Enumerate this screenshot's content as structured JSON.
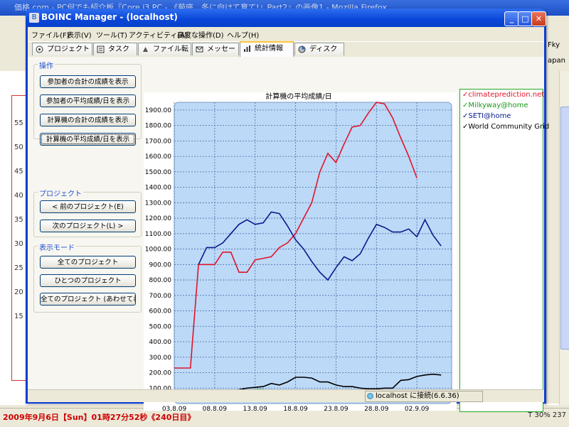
{
  "background": {
    "firefox_title": "価格.com - PC何でも紹介板『Core i3 PC - 《菊座、冬に向けて育て!』Part2』の画像1 - Mozilla Firefox",
    "status_text": "2009年9月6日【Sun】01時27分52秒《240日目》",
    "tray_text": "T 30% 237",
    "left_axis_nums": [
      "55",
      "50",
      "45",
      "40",
      "35",
      "30",
      "25",
      "20",
      "15"
    ],
    "right_notes": [
      "Fky",
      "apan"
    ]
  },
  "window": {
    "title": "BOINC Manager - (localhost)",
    "title_icon": "boinc-icon",
    "controls": [
      "_",
      "□",
      "✕"
    ]
  },
  "menu": [
    "ファイル(F)",
    "表示(V)",
    "ツール(T)",
    "アクティビティ(A)",
    "高度な操作(D)",
    "ヘルプ(H)"
  ],
  "tabs": [
    {
      "label": "プロジェクト",
      "icon": "projects-icon"
    },
    {
      "label": "タスク",
      "icon": "tasks-icon"
    },
    {
      "label": "ファイル転送",
      "icon": "transfers-icon"
    },
    {
      "label": "メッセージ",
      "icon": "messages-icon"
    },
    {
      "label": "統計情報",
      "icon": "statistics-icon",
      "active": true
    },
    {
      "label": "ディスク",
      "icon": "disk-icon"
    }
  ],
  "sidebar": {
    "ops_label": "操作",
    "ops_buttons": [
      "参加者の合計の成績を表示",
      "参加者の平均成績/日を表示",
      "計算機の合計の成績を表示",
      "計算機の平均成績/日を表示"
    ],
    "project_label": "プロジェクト",
    "project_buttons": [
      "< 前のプロジェクト(E)",
      "次のプロジェクト(L) >"
    ],
    "mode_label": "表示モード",
    "mode_buttons": [
      "全てのプロジェクト",
      "ひとつのプロジェクト",
      "全てのプロジェクト (あわせて表示)"
    ]
  },
  "legend": [
    {
      "name": "climateprediction.net",
      "color": "#e0142a"
    },
    {
      "name": "Milkyway@home",
      "color": "#1a9a1a"
    },
    {
      "name": "SETI@home",
      "color": "#0a1a8c"
    },
    {
      "name": "World Community Grid",
      "color": "#000000"
    }
  ],
  "statusbar": {
    "connection": "localhost に接続(6.6.36)"
  },
  "chart_data": {
    "type": "line",
    "title": "計算機の平均成績/日",
    "xlabel": "",
    "ylabel": "",
    "x_ticks": [
      "03.8.09",
      "08.8.09",
      "13.8.09",
      "18.8.09",
      "23.8.09",
      "28.8.09",
      "02.9.09"
    ],
    "y_ticks": [
      "100.00",
      "200.00",
      "300.00",
      "400.00",
      "500.00",
      "600.00",
      "700.00",
      "800.00",
      "900.00",
      "1000.00",
      "1100.00",
      "1200.00",
      "1300.00",
      "1400.00",
      "1500.00",
      "1600.00",
      "1700.00",
      "1800.00",
      "1900.00"
    ],
    "ylim": [
      0,
      1950
    ],
    "xlim": [
      3,
      37.3
    ],
    "grid": true,
    "bg_color": "#bcd9f7",
    "series": [
      {
        "name": "climateprediction.net",
        "color": "#e0142a",
        "x": [
          3,
          4,
          5,
          6,
          7,
          8,
          9,
          10,
          11,
          12,
          13,
          14,
          15,
          16,
          17,
          18,
          19,
          20,
          21,
          22,
          23,
          24,
          25,
          26,
          27,
          28,
          29,
          30,
          31,
          32,
          33
        ],
        "y": [
          230,
          230,
          230,
          900,
          900,
          900,
          980,
          980,
          850,
          850,
          930,
          940,
          950,
          1010,
          1040,
          1100,
          1200,
          1300,
          1500,
          1620,
          1560,
          1680,
          1790,
          1800,
          1880,
          1950,
          1940,
          1850,
          1720,
          1600,
          1460
        ]
      },
      {
        "name": "Milkyway@home",
        "color": "#1a9a1a",
        "x": [
          5,
          6,
          7,
          8,
          9,
          10,
          11,
          12,
          13,
          14,
          15,
          16,
          17,
          18,
          19,
          20,
          21,
          22,
          23,
          24,
          25,
          26,
          27,
          28,
          29,
          30,
          31,
          32,
          33
        ],
        "y": [
          40,
          40,
          40,
          40,
          50,
          60,
          70,
          80,
          90,
          90,
          80,
          75,
          70,
          65,
          60,
          55,
          50,
          45,
          40,
          40,
          40,
          40,
          30,
          30,
          30,
          35,
          40,
          40,
          40
        ]
      },
      {
        "name": "SETI@home",
        "color": "#0a1a8c",
        "x": [
          6,
          7,
          8,
          9,
          10,
          11,
          12,
          13,
          14,
          15,
          16,
          17,
          18,
          19,
          20,
          21,
          22,
          23,
          24,
          25,
          26,
          27,
          28,
          29,
          30,
          31,
          32,
          33,
          34,
          35,
          36
        ],
        "y": [
          900,
          1010,
          1010,
          1040,
          1100,
          1160,
          1190,
          1160,
          1170,
          1240,
          1230,
          1150,
          1060,
          1000,
          920,
          850,
          800,
          880,
          950,
          925,
          970,
          1070,
          1160,
          1140,
          1110,
          1110,
          1130,
          1080,
          1190,
          1090,
          1020
        ]
      },
      {
        "name": "World Community Grid",
        "color": "#000000",
        "x": [
          8,
          9,
          10,
          11,
          12,
          13,
          14,
          15,
          16,
          17,
          18,
          19,
          20,
          21,
          22,
          23,
          24,
          25,
          26,
          27,
          28,
          29,
          30,
          31,
          32,
          33,
          34,
          35,
          36
        ],
        "y": [
          40,
          60,
          80,
          90,
          100,
          105,
          110,
          130,
          120,
          140,
          170,
          170,
          165,
          140,
          140,
          120,
          110,
          110,
          100,
          95,
          95,
          100,
          100,
          150,
          155,
          175,
          185,
          190,
          185
        ]
      }
    ]
  }
}
